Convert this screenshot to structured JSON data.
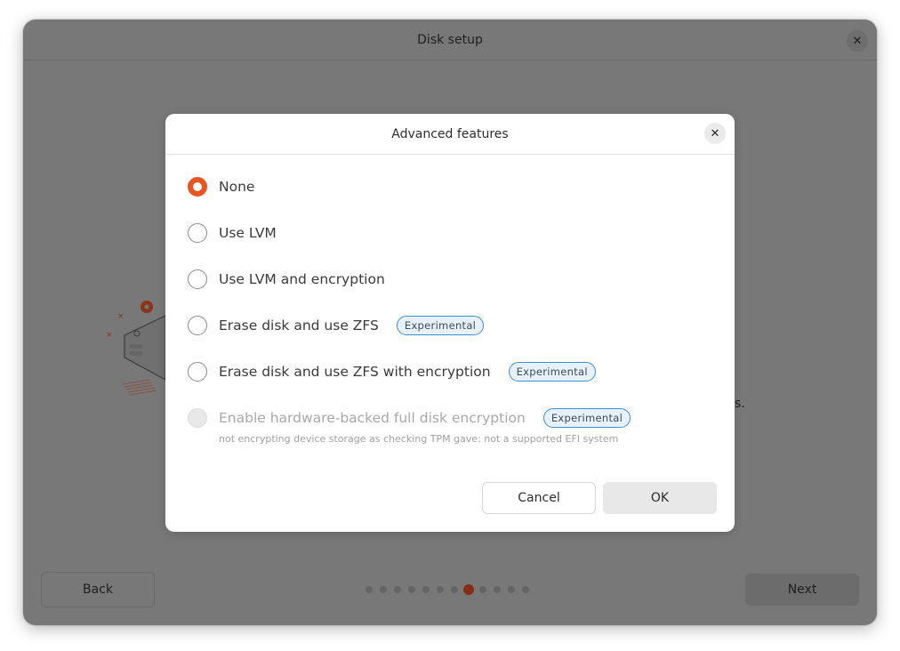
{
  "window": {
    "title": "Disk setup",
    "close_icon": "close-icon",
    "background_text_tail": "s.",
    "back_label": "Back",
    "next_label": "Next",
    "pager": {
      "total_steps": 12,
      "current_step": 8
    },
    "accent_color": "#e95420"
  },
  "dialog": {
    "title": "Advanced features",
    "close_icon": "close-icon",
    "options": [
      {
        "label": "None",
        "checked": true,
        "disabled": false,
        "badge": null
      },
      {
        "label": "Use LVM",
        "checked": false,
        "disabled": false,
        "badge": null
      },
      {
        "label": "Use LVM and encryption",
        "checked": false,
        "disabled": false,
        "badge": null
      },
      {
        "label": "Erase disk and use ZFS",
        "checked": false,
        "disabled": false,
        "badge": "Experimental"
      },
      {
        "label": "Erase disk and use ZFS with encryption",
        "checked": false,
        "disabled": false,
        "badge": "Experimental"
      },
      {
        "label": "Enable hardware-backed full disk encryption",
        "checked": false,
        "disabled": true,
        "badge": "Experimental",
        "description": "not encrypting device storage as checking TPM gave: not a supported EFI system"
      }
    ],
    "cancel_label": "Cancel",
    "ok_label": "OK"
  }
}
